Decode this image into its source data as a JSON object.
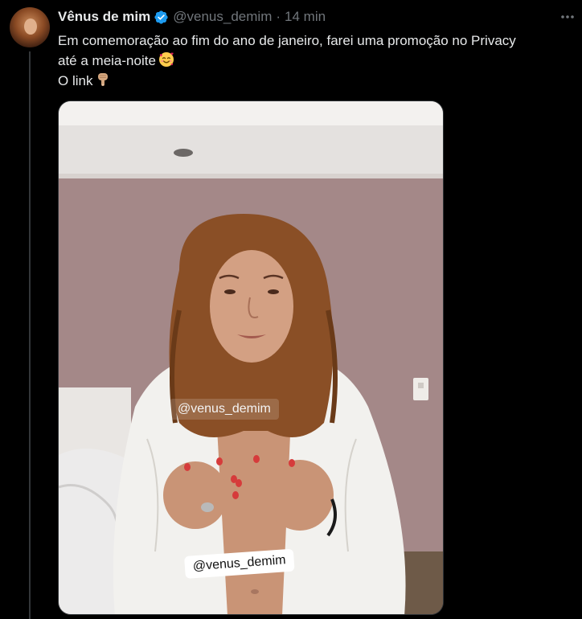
{
  "tweet": {
    "display_name": "Vênus de mim",
    "handle": "@venus_demim",
    "separator": "·",
    "time": "14 min",
    "text_line1": "Em comemoração ao fim do ano de janeiro, farei uma promoção no Privacy",
    "text_line2": "até a meia-noite",
    "text_line3": "O link",
    "verified": true
  },
  "icons": {
    "verified": "verified-badge-icon",
    "more": "more-options-icon",
    "emoji_1": "smiling-face-with-hearts-emoji",
    "emoji_2": "backhand-index-pointing-down-emoji"
  },
  "media": {
    "watermark_top": "@venus_demim",
    "watermark_bottom": "@venus_demim"
  },
  "colors": {
    "background": "#000000",
    "text_primary": "#e7e9ea",
    "text_secondary": "#71767b",
    "verified_blue": "#1d9bf0",
    "thread_line": "#333639"
  }
}
